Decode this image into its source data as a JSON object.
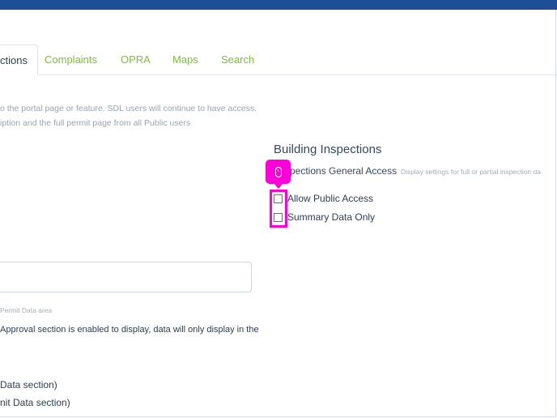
{
  "tabs": [
    {
      "label": "ctions",
      "active": true
    },
    {
      "label": "Complaints",
      "active": false
    },
    {
      "label": "OPRA",
      "active": false
    },
    {
      "label": "Maps",
      "active": false
    },
    {
      "label": "Search",
      "active": false
    }
  ],
  "intro": {
    "line1": "o the portal page or feature. SDL users will continue to have access.",
    "line2": "iption and the full permit page from all Public users"
  },
  "building_inspections": {
    "title": "Building Inspections",
    "setting_label": "spections General Access",
    "setting_hint": "Display settings for full or partial inspection da",
    "options": [
      {
        "label": "Allow Public Access",
        "checked": false
      },
      {
        "label": "Summary Data Only",
        "checked": false
      }
    ]
  },
  "permit": {
    "input_value": "",
    "note": "Permit Data area",
    "approval_text": "Approval section is enabled to display, data will only display in the",
    "list": [
      "Data section)",
      "nit Data section)"
    ]
  },
  "annotation": {
    "highlight_color": "#ff00d8",
    "icon": "mouse-icon"
  }
}
